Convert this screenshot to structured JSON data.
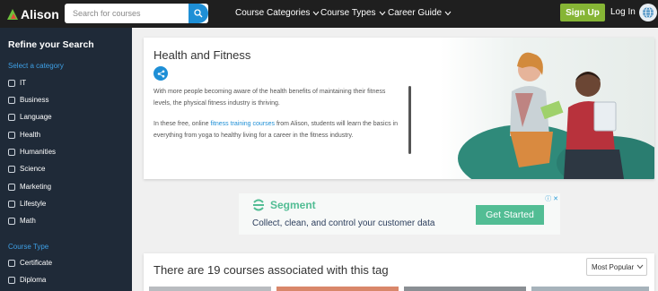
{
  "header": {
    "logo_text": "Alison",
    "search_placeholder": "Search for courses",
    "nav": [
      {
        "label": "Course Categories"
      },
      {
        "label": "Course Types"
      },
      {
        "label": "Career Guide"
      }
    ],
    "signup_label": "Sign Up",
    "login_label": "Log In"
  },
  "sidebar": {
    "title": "Refine your Search",
    "category_heading": "Select a category",
    "categories": [
      "IT",
      "Business",
      "Language",
      "Health",
      "Humanities",
      "Science",
      "Marketing",
      "Lifestyle",
      "Math"
    ],
    "course_type_heading": "Course Type",
    "course_types": [
      "Certificate",
      "Diploma"
    ]
  },
  "hero": {
    "title": "Health and Fitness",
    "paragraph1": "With more people becoming aware of the health benefits of maintaining their fitness levels, the physical fitness industry is thriving.",
    "paragraph2_before": "In these free, online ",
    "paragraph2_link": "fitness training courses",
    "paragraph2_after": " from Alison, students will learn the basics in everything from yoga to healthy living for a career in the fitness industry."
  },
  "ad": {
    "brand": "Segment",
    "tagline": "Collect, clean, and control your customer data",
    "cta": "Get Started",
    "close_glyphs": "ⓘ ✕"
  },
  "results": {
    "title": "There are 19 courses associated with this tag",
    "sort_value": "Most Popular"
  },
  "colors": {
    "topbar": "#1f1f1f",
    "sidebar": "#1f2a38",
    "accent_blue": "#1e8fd6",
    "signup_green": "#86b535",
    "segment_green": "#52bd94"
  }
}
